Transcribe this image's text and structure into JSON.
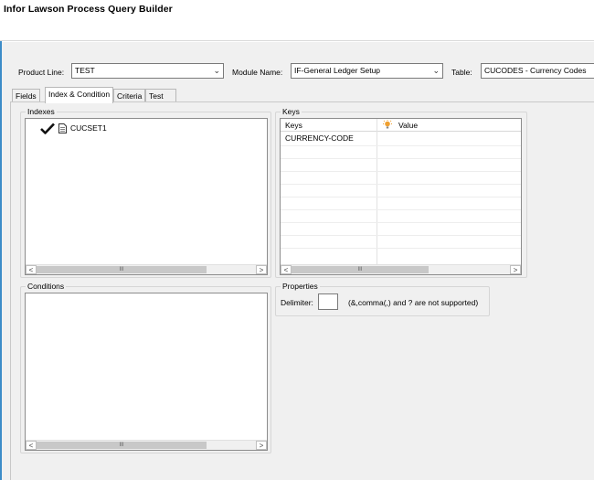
{
  "window": {
    "title": "Infor Lawson Process Query Builder"
  },
  "toolbar": {
    "product_line_label": "Product Line:",
    "product_line_value": "TEST",
    "module_name_label": "Module Name:",
    "module_name_value": "IF-General Ledger Setup",
    "table_label": "Table:",
    "table_value": "CUCODES - Currency Codes"
  },
  "tabs": [
    {
      "label": "Fields"
    },
    {
      "label": "Index & Condition"
    },
    {
      "label": "Criteria"
    },
    {
      "label": "Test"
    }
  ],
  "active_tab": "Index & Condition",
  "indexes": {
    "title": "Indexes",
    "items": [
      {
        "label": "CUCSET1",
        "checked": true
      }
    ],
    "scroll_grip": "III"
  },
  "keys": {
    "title": "Keys",
    "columns": [
      "Keys",
      "Value"
    ],
    "rows": [
      {
        "key": "CURRENCY-CODE",
        "value": ""
      }
    ],
    "scroll_grip": "III"
  },
  "conditions": {
    "title": "Conditions",
    "scroll_grip": "III"
  },
  "properties": {
    "title": "Properties",
    "delimiter_label": "Delimiter:",
    "delimiter_value": "",
    "delimiter_note": "(&,comma(,) and ? are not supported)"
  },
  "icons": {
    "checkmark": "check-icon",
    "document": "document-icon",
    "lightbulb": "lightbulb-icon",
    "scroll_left": "arrow-left-icon",
    "scroll_right": "arrow-right-icon",
    "dropdown": "chevron-down-icon"
  },
  "colors": {
    "accent": "#3c8cc8",
    "lightbulb": "#f0a030"
  }
}
